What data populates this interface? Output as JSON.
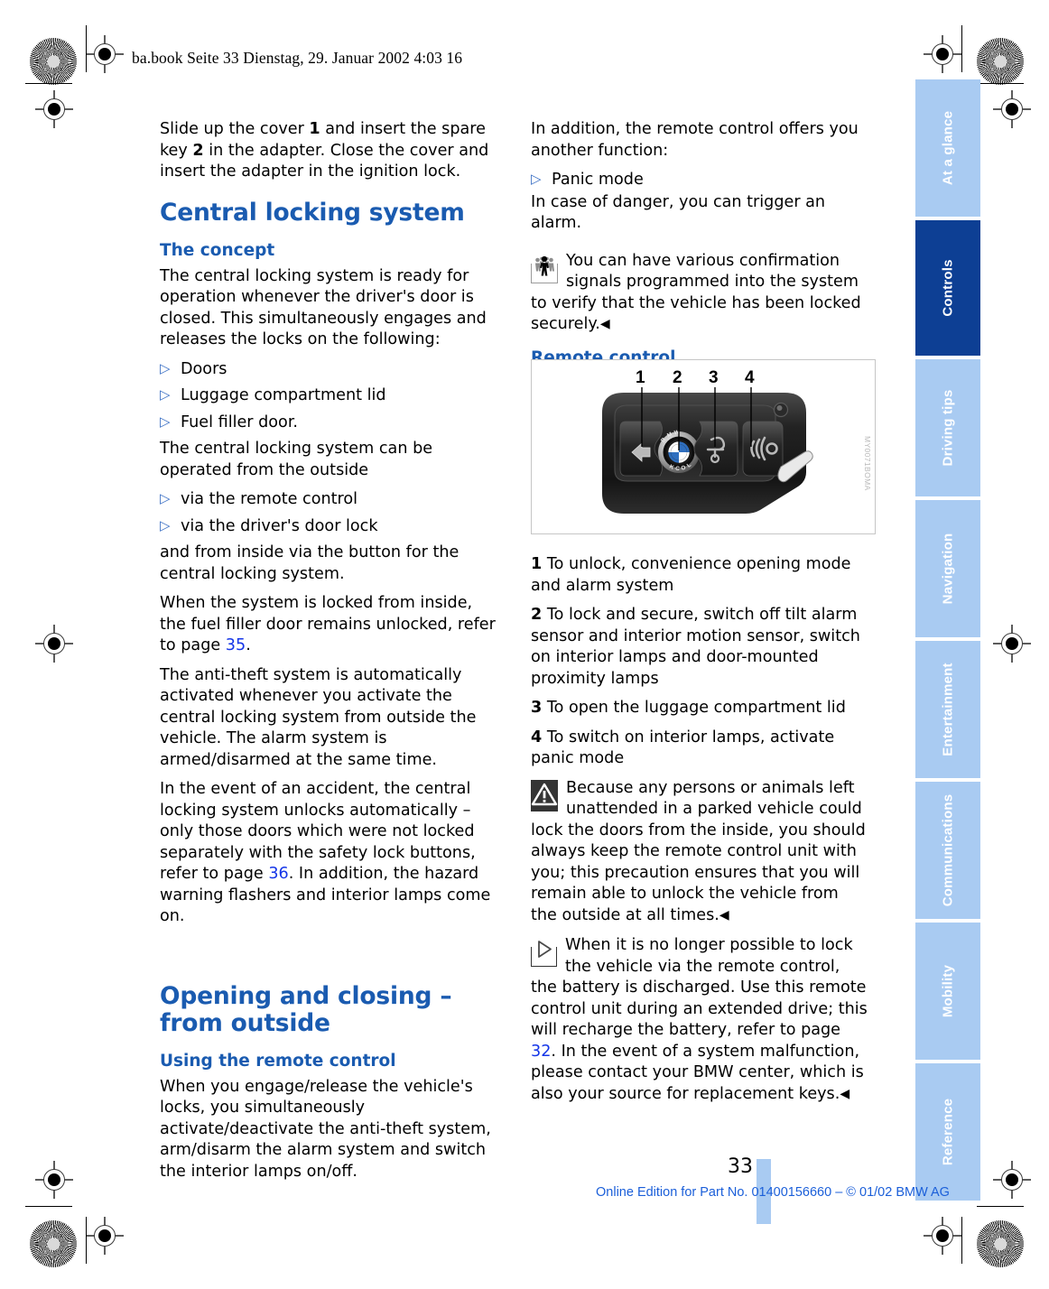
{
  "header": {
    "file_line": "ba.book  Seite 33  Dienstag, 29. Januar 2002  4:03 16"
  },
  "left_column": {
    "intro_paragraph_pre": "Slide up the cover ",
    "intro_bold_1": "1",
    "intro_paragraph_mid": " and insert the spare key ",
    "intro_bold_2": "2",
    "intro_paragraph_post": " in the adapter. Close the cover and insert the adapter in the ignition lock.",
    "chapter_title": "Central locking system",
    "concept_heading": "The concept",
    "concept_paragraph": "The central locking system is ready for operation whenever the driver's door is closed. This simultaneously engages and releases the locks on the following:",
    "locks_list": [
      "Doors",
      "Luggage compartment lid",
      "Fuel filler door."
    ],
    "operated_paragraph": "The central locking system can be operated from the outside",
    "operated_list": [
      "via the remote control",
      "via the driver's door lock"
    ],
    "inside_paragraph": "and from inside via the button for the central locking system.",
    "fuel_para_pre": "When the system is locked from inside, the fuel filler door remains unlocked, refer to page ",
    "fuel_para_link": "35",
    "fuel_para_post": ".",
    "antitheft_paragraph": "The anti-theft system is automatically activated whenever you activate the central locking system from outside the vehicle. The alarm system is armed/disarmed at the same time.",
    "accident_para_pre": "In the event of an accident, the central locking system unlocks automatically – only those doors which were not locked separately with the safety lock buttons, refer to page ",
    "accident_para_link": "36",
    "accident_para_post": ". In addition, the hazard warning flashers and interior lamps come on.",
    "chapter_title_2": "Opening and closing – from outside",
    "remote_heading": "Using the remote control",
    "remote_paragraph": "When you engage/release the vehicle's locks, you simultaneously activate/deactivate the anti-theft system, arm/disarm the alarm system and switch the interior lamps on/off."
  },
  "right_column": {
    "addition_paragraph": "In addition, the remote control offers you another function:",
    "panic_bullet": "Panic mode",
    "panic_paragraph": "In case of danger, you can trigger an alarm.",
    "confirm_note": "You can have various confirmation signals programmed into the system to verify that the vehicle has been locked securely.",
    "confirm_note_end": "◀",
    "remote_control_heading": "Remote control",
    "figure": {
      "image_code": "MY0071BOMA",
      "callouts": [
        "1",
        "2",
        "3",
        "4"
      ],
      "bmw_roundel_text": "BMW",
      "lock_text": "LOCK"
    },
    "legend": [
      {
        "num": "1",
        "text": "To unlock, convenience opening mode and alarm system"
      },
      {
        "num": "2",
        "text": "To lock and secure, switch off tilt alarm sensor and interior motion sensor, switch on interior lamps and door-mounted proximity lamps"
      },
      {
        "num": "3",
        "text": "To open the luggage compartment lid"
      },
      {
        "num": "4",
        "text": "To switch on interior lamps, activate panic mode"
      }
    ],
    "warning_note": "Because any persons or animals left unattended in a parked vehicle could lock the doors from the inside, you should always keep the remote control unit with you; this precaution ensures that you will remain able to unlock the vehicle from the outside at all times.",
    "warning_note_end": "◀",
    "battery_note_pre": "When it is no longer possible to lock the vehicle via the remote control, the battery is discharged. Use this remote control unit during an extended drive; this will recharge the battery, refer to page ",
    "battery_note_link": "32",
    "battery_note_post": ". In the event of a system malfunction, please contact your BMW center, which is also your source for replacement keys.",
    "battery_note_end": "◀"
  },
  "sidebar": {
    "tabs": [
      {
        "label": "At a glance",
        "active": false
      },
      {
        "label": "Controls",
        "active": true
      },
      {
        "label": "Driving tips",
        "active": false
      },
      {
        "label": "Navigation",
        "active": false
      },
      {
        "label": "Entertainment",
        "active": false
      },
      {
        "label": "Communications",
        "active": false
      },
      {
        "label": "Mobility",
        "active": false
      },
      {
        "label": "Reference",
        "active": false
      }
    ]
  },
  "footer": {
    "page_number": "33",
    "online_edition": "Online Edition for Part No. 01400156660 – © 01/02 BMW AG"
  },
  "colors": {
    "heading_blue": "#1a5bb0",
    "link_blue": "#1435e8",
    "tab_blue": "#a9cbf2",
    "tab_active_blue": "#0d3f94",
    "footer_blue": "#1b5fd9"
  }
}
